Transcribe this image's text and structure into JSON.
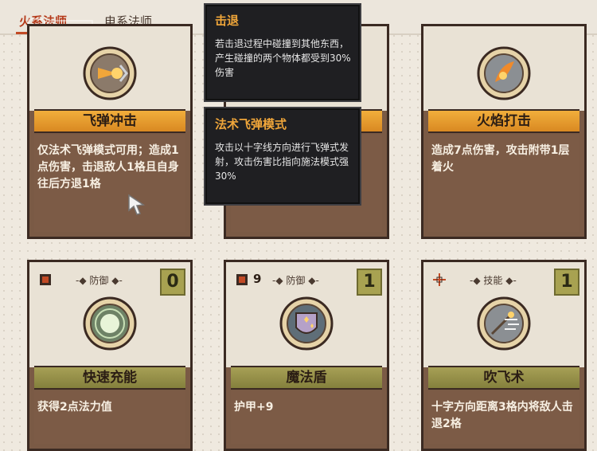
{
  "tabs": [
    {
      "label": "火系法师",
      "active": true
    },
    {
      "label": "电系法师",
      "active": false
    }
  ],
  "watermark": {
    "icon": "gamersky-logo"
  },
  "colors": {
    "accent_orange": "#f1ae3c",
    "accent_olive": "#a7a055",
    "card_body": "#7c5b46",
    "tooltip_title": "#f0a63a"
  },
  "tooltips": [
    {
      "title": "击退",
      "body": "若击退过程中碰撞到其他东西，产生碰撞的两个物体都受到30%伤害"
    },
    {
      "title": "法术飞弹模式",
      "body": "攻击以十字线方向进行飞弹式发射，攻击伤害比指向施法模式强30%"
    }
  ],
  "cards_top": [
    {
      "name": "飞弹冲击",
      "desc": "仅法术飞弹模式可用；造成1点伤害，击退敌人1格且自身往后方退1格",
      "icon": "fire-missile-icon"
    },
    {
      "name": "",
      "desc": "",
      "icon": ""
    },
    {
      "name": "火焰打击",
      "desc": "造成7点伤害，攻击附带1层着火",
      "icon": "flame-strike-icon"
    }
  ],
  "cards_bottom": [
    {
      "name": "快速充能",
      "desc": "获得2点法力值",
      "type": "防御",
      "cost": "0",
      "icon": "energy-orb-icon",
      "stat": ""
    },
    {
      "name": "魔法盾",
      "desc": "护甲+9",
      "type": "防御",
      "cost": "1",
      "icon": "magic-shield-icon",
      "stat": "9"
    },
    {
      "name": "吹飞术",
      "desc": "十字方向距离3格内将敌人击退2格",
      "type": "技能",
      "cost": "1",
      "icon": "wind-blow-icon",
      "stat": ""
    }
  ]
}
